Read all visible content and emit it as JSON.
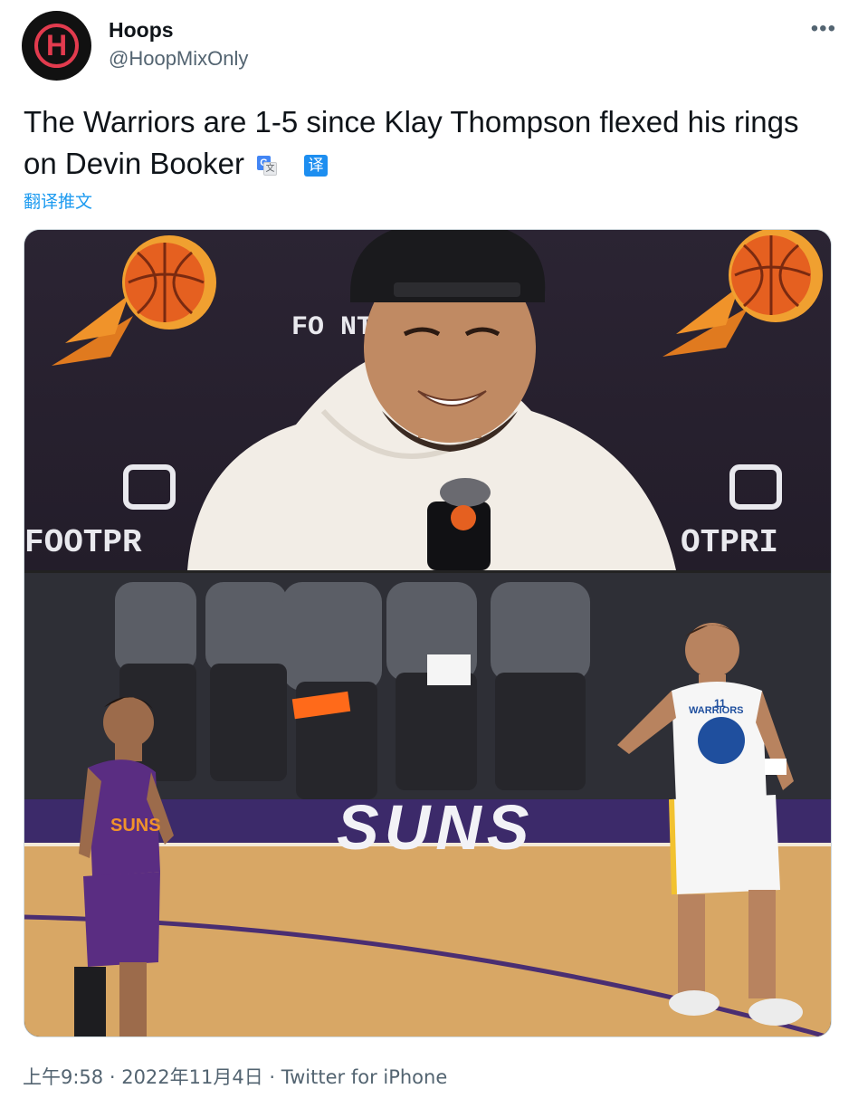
{
  "author": {
    "name": "Hoops",
    "handle": "@HoopMixOnly",
    "avatar_letter": "H",
    "avatar_color": "#e23b4e"
  },
  "more_menu": "•••",
  "tweet": {
    "text": "The Warriors are 1-5 since Klay Thompson flexed his rings on Devin Booker",
    "translate_icon_badge": "译",
    "translate_link": "翻译推文"
  },
  "media": {
    "top_panel": {
      "backdrop_text_left": "FOOTPR",
      "backdrop_text_center": "FO    NT",
      "backdrop_text_right": "OTPRI"
    },
    "bottom_panel": {
      "court_text": "SUNS",
      "jersey_left": "SUNS",
      "jersey_right": "WARRIORS",
      "jersey_right_number": "11"
    }
  },
  "footer": {
    "time": "上午9:58",
    "separator": " · ",
    "date": "2022年11月4日",
    "source": "Twitter for iPhone"
  },
  "colors": {
    "accent": "#1d9bf0",
    "text": "#0f1419",
    "secondary": "#536471",
    "suns_orange": "#e56020",
    "suns_purple": "#5a2d82",
    "court": "#d9a866"
  }
}
